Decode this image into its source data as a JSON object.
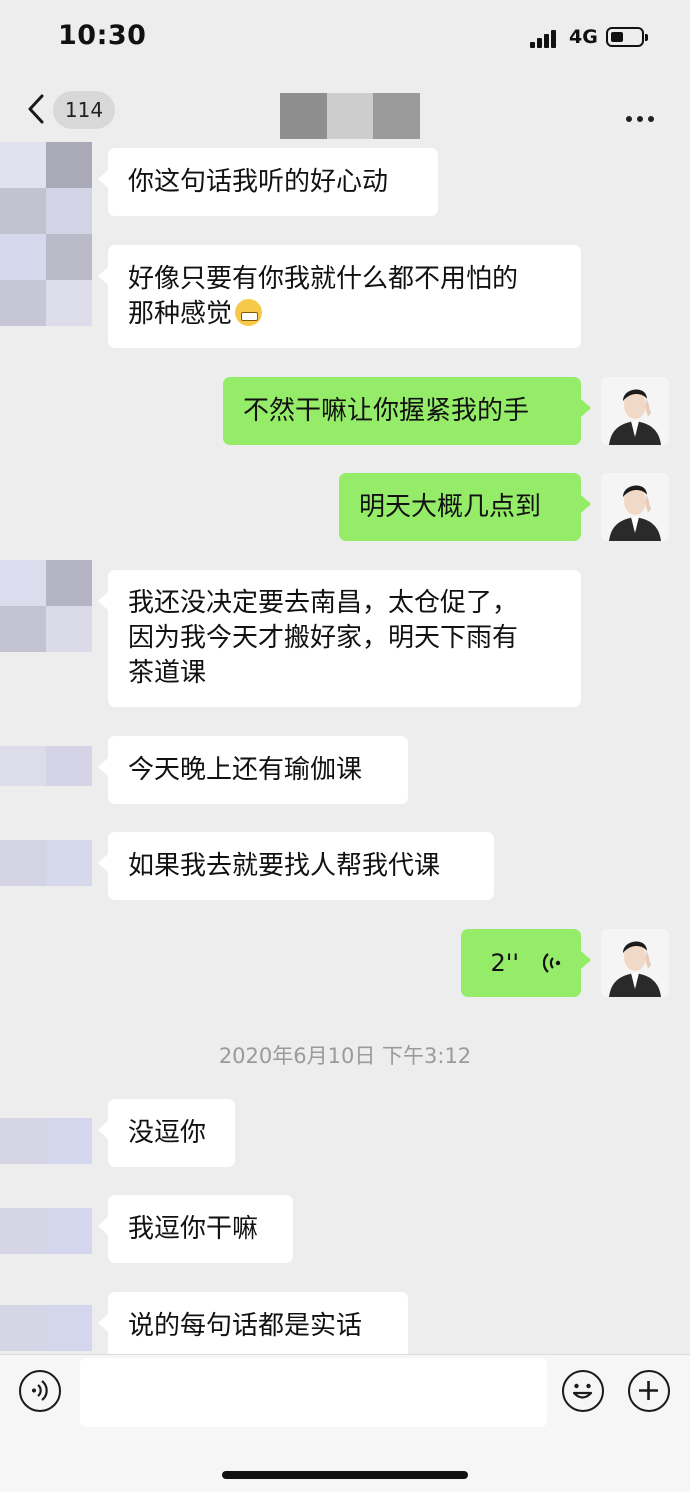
{
  "status_bar": {
    "time": "10:30",
    "network": "4G",
    "signal_icon": "cellular-signal-icon",
    "battery_icon": "battery-low-icon"
  },
  "nav": {
    "back_icon": "chevron-left-icon",
    "unread_count": "114",
    "more_icon": "more-dots-icon"
  },
  "messages": [
    {
      "side": "in",
      "text": "你这句话我听的好心动"
    },
    {
      "side": "in",
      "text": "好像只要有你我就什么都不用怕的\n那种感觉",
      "emoji": "grimacing-face-emoji"
    },
    {
      "side": "out",
      "text": "不然干嘛让你握紧我的手"
    },
    {
      "side": "out",
      "text": "明天大概几点到"
    },
    {
      "side": "in",
      "text": "我还没决定要去南昌，太仓促了，\n因为我今天才搬好家，明天下雨有\n茶道课"
    },
    {
      "side": "in",
      "text": "今天晚上还有瑜伽课"
    },
    {
      "side": "in",
      "text": "如果我去就要找人帮我代课"
    },
    {
      "side": "out",
      "type": "voice",
      "duration": "2''",
      "icon": "voice-wave-icon"
    },
    {
      "type": "timestamp",
      "text": "2020年6月10日 下午3:12"
    },
    {
      "side": "in",
      "text": "没逗你"
    },
    {
      "side": "in",
      "text": "我逗你干嘛"
    },
    {
      "side": "in",
      "text": "说的每句话都是实话"
    }
  ],
  "input_bar": {
    "voice_icon": "voice-input-icon",
    "emoji_icon": "smiley-icon",
    "plus_icon": "plus-icon",
    "placeholder": ""
  },
  "colors": {
    "background": "#ededed",
    "incoming_bubble": "#ffffff",
    "outgoing_bubble": "#95ec69",
    "timestamp": "#9a9a9a"
  }
}
